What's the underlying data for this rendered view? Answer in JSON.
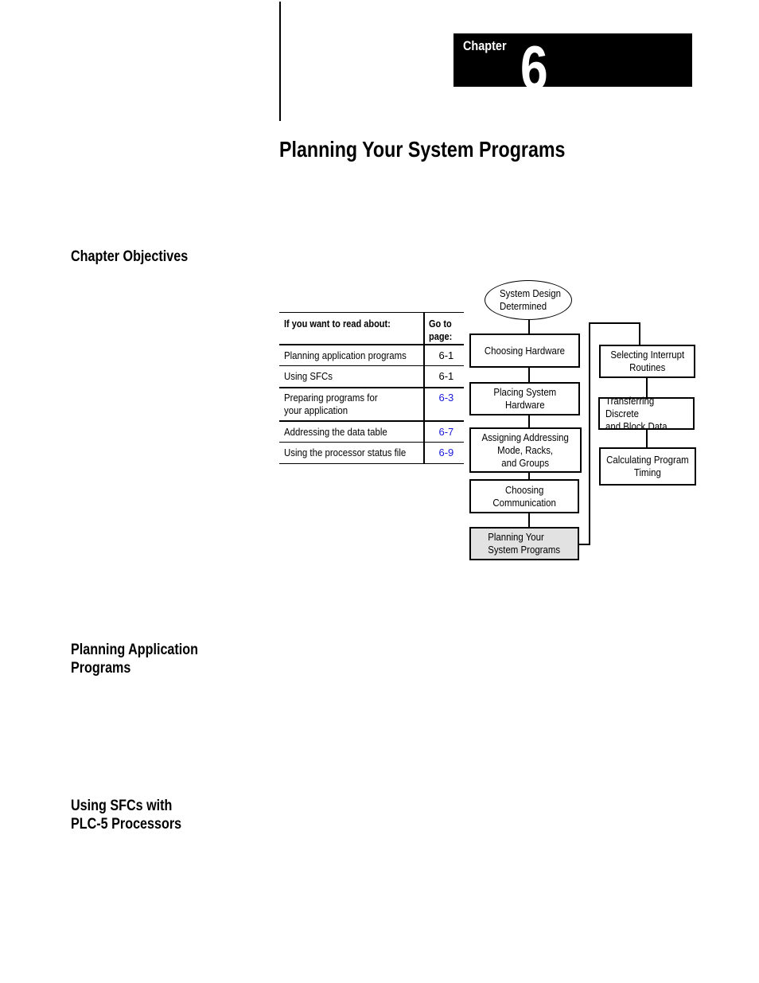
{
  "chapter": {
    "label": "Chapter",
    "number": "6"
  },
  "page_title": "Planning Your System Programs",
  "sections": [
    {
      "id": "chapter-objectives",
      "heading": [
        "Chapter Objectives"
      ]
    },
    {
      "id": "planning-application-programs",
      "heading": [
        "Planning Application",
        "Programs"
      ]
    },
    {
      "id": "using-sfcs",
      "heading": [
        "Using SFCs with",
        "PLC-5 Processors"
      ]
    }
  ],
  "objectives_table": {
    "headers": [
      "If you want to read about:",
      "Go to page:"
    ],
    "header_lines": {
      "col1": "If you want to read about:",
      "col2_line1": "Go to",
      "col2_line2": "page:"
    },
    "rows": [
      {
        "topic": "Planning application programs",
        "page": "6-1",
        "is_link": false
      },
      {
        "topic": "Using SFCs",
        "page": "6-1",
        "is_link": false
      },
      {
        "topic_line1": "Preparing programs for",
        "topic_line2": "your application",
        "topic": "Preparing programs for your application",
        "page": "6-3",
        "is_link": true
      },
      {
        "topic": "Addressing the data table",
        "page": "6-7",
        "is_link": true
      },
      {
        "topic": "Using the processor status file",
        "page": "6-9",
        "is_link": true
      }
    ],
    "link_color": "#1a1adb"
  },
  "flowchart": {
    "start": "System Design\nDetermined",
    "main_steps": [
      "Choosing Hardware",
      "Placing System\nHardware",
      "Assigning Addressing\nMode, Racks,\nand Groups",
      "Choosing\nCommunication",
      "Planning Your\nSystem Programs"
    ],
    "current_step": "Planning Your\nSystem Programs",
    "side_steps": [
      "Selecting Interrupt\nRoutines",
      "Transferring Discrete\nand Block Data",
      "Calculating Program\nTiming"
    ],
    "highlight_color": "#e2e2e2"
  }
}
